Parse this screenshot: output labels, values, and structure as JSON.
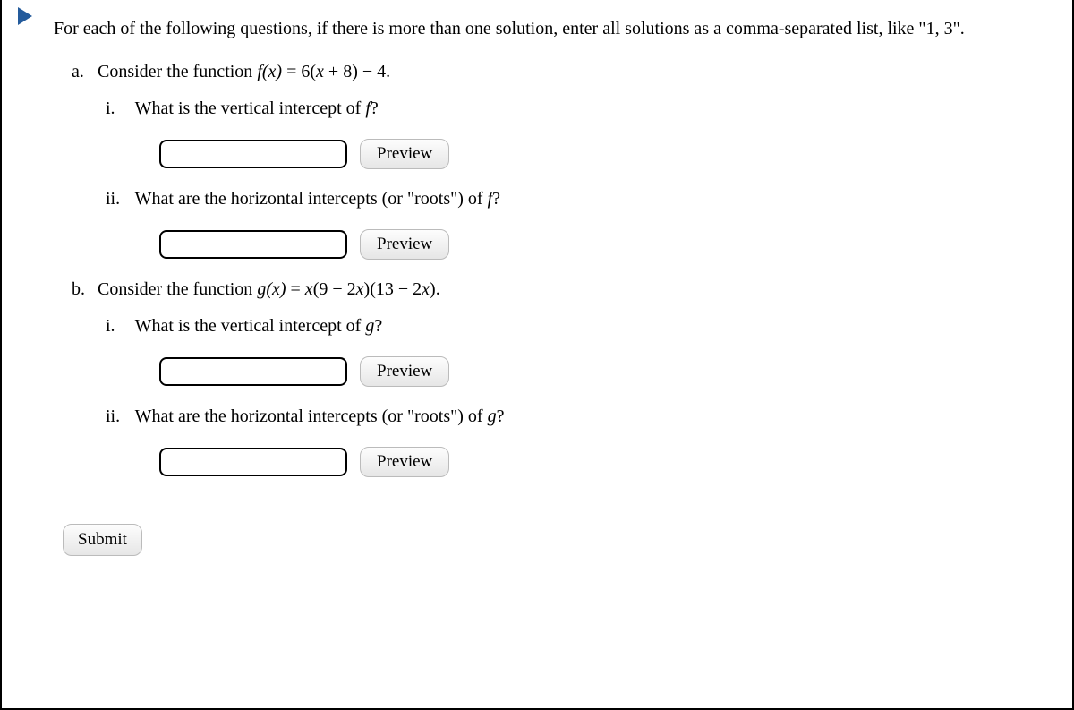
{
  "intro": "For each of the following questions, if there is more than one solution, enter all solutions as a comma-separated list, like \"1, 3\".",
  "parts": {
    "a": {
      "marker": "a.",
      "prompt_prefix": "Consider the function ",
      "func_lhs": "f(x)",
      "equals": " = ",
      "func_rhs": "6(x + 8) − 4.",
      "sub": {
        "i": {
          "marker": "i.",
          "text_pre": "What is the vertical intercept of ",
          "fname": "f",
          "text_post": "?"
        },
        "ii": {
          "marker": "ii.",
          "text_pre": "What are the horizontal intercepts (or \"roots\") of ",
          "fname": "f",
          "text_post": "?"
        }
      }
    },
    "b": {
      "marker": "b.",
      "prompt_prefix": "Consider the function ",
      "func_lhs": "g(x)",
      "equals": " = ",
      "func_rhs": "x(9 − 2x)(13 − 2x).",
      "sub": {
        "i": {
          "marker": "i.",
          "text_pre": "What is the vertical intercept of ",
          "fname": "g",
          "text_post": "?"
        },
        "ii": {
          "marker": "ii.",
          "text_pre": "What are the horizontal intercepts (or \"roots\") of ",
          "fname": "g",
          "text_post": "?"
        }
      }
    }
  },
  "buttons": {
    "preview": "Preview",
    "submit": "Submit"
  },
  "inputs": {
    "a_i": "",
    "a_ii": "",
    "b_i": "",
    "b_ii": ""
  }
}
